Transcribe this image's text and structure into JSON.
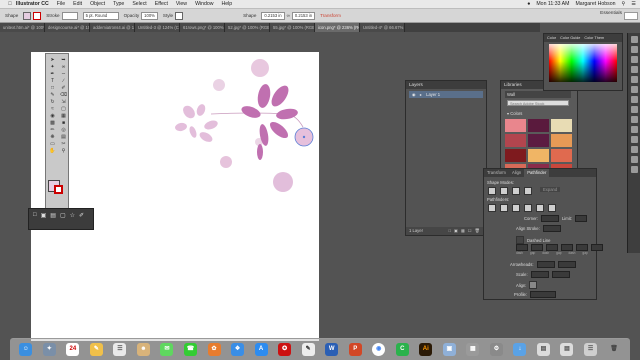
{
  "menubar": {
    "apple": "",
    "app": "Illustrator CC",
    "items": [
      "File",
      "Edit",
      "Object",
      "Type",
      "Select",
      "Effect",
      "View",
      "Window",
      "Help"
    ],
    "clock": "Mon 11:33 AM",
    "user": "Margaret Hobson"
  },
  "controlbar": {
    "selection_label": "Shape",
    "stroke_label": "Stroke",
    "stroke_value": "",
    "brush_label": "5 pt. Round",
    "opacity_label": "Opacity",
    "opacity_value": "100%",
    "style_label": "Style",
    "shape_label": "Shape",
    "w_value": "0.2153 in",
    "h_value": "0.2153 in",
    "transform_label": "Transform",
    "workspace": "Essentials"
  },
  "tabs": [
    {
      "label": "unitext.htm.ai* @ 100% (R...",
      "active": false
    },
    {
      "label": "designcourse.ai* @ 100% (...",
      "active": false
    },
    {
      "label": "addemiatrons4.ai @ 100% ...",
      "active": false
    },
    {
      "label": "Untitled-3 @ 124% (CMYK...",
      "active": false
    },
    {
      "label": "61rows.png* @ 100% (RGB...",
      "active": false
    },
    {
      "label": "52.jpg* @ 100% (RGB/GPU P...",
      "active": false
    },
    {
      "label": "55.jpg* @ 100% (RGB/GPU P...",
      "active": false
    },
    {
      "label": "icon.png* @ 236% (RGB...",
      "active": true
    },
    {
      "label": "Untitled-4* @ 66.67% (CM...",
      "active": false
    }
  ],
  "layers": {
    "title": "Layers",
    "row_label": "Layer 1",
    "footer": "1 Layer"
  },
  "libraries": {
    "title": "Libraries",
    "library_name": "Wall",
    "search_placeholder": "Search Adobe Stock",
    "section_colors": "Colors",
    "swatches": [
      "#e9868d",
      "#5a1a3d",
      "#e8dcb4",
      "#b2454e",
      "#5c1b41",
      "#e79a56",
      "#7e1a1e",
      "#f0b565",
      "#e06a4f",
      "#d86a58",
      "#8a2b4a",
      "#c9473c"
    ]
  },
  "colorpanel": {
    "tabs": [
      "Color",
      "Color Guide",
      "Color Them"
    ]
  },
  "pathfinder": {
    "tabs": [
      "Transform",
      "Align",
      "Pathfinder"
    ],
    "active_tab": "Pathfinder",
    "shape_modes_label": "Shape Modes:",
    "expand_label": "Expand",
    "pathfinders_label": "Pathfinders:",
    "corner_label": "Corner:",
    "limit_label": "Limit:",
    "align_stroke_label": "Align Stroke:",
    "dashed_line_label": "Dashed Line",
    "dash_labels": [
      "dash",
      "gap",
      "dash",
      "gap",
      "dash",
      "gap"
    ],
    "arrowheads_label": "Arrowheads:",
    "scale_label": "Scale:",
    "align_label": "Align:",
    "profile_label": "Profile:"
  },
  "dock": {
    "calendar_day": "24",
    "icons": [
      "finder-icon",
      "launchpad-icon",
      "calendar-icon",
      "photos-icon",
      "notes-icon",
      "reminders-icon",
      "contacts-icon",
      "messages-icon",
      "facetime-icon",
      "safari-icon",
      "app-store-icon",
      "acrobat-icon",
      "textedit-icon",
      "word-icon",
      "powerpoint-icon",
      "chrome-icon",
      "camtasia-icon",
      "illustrator-icon",
      "preview-icon",
      "archive-icon",
      "system-prefs-icon",
      "downloads-folder-icon",
      "documents-icon",
      "desktop-icon",
      "stack-icon",
      "trash-icon"
    ]
  }
}
